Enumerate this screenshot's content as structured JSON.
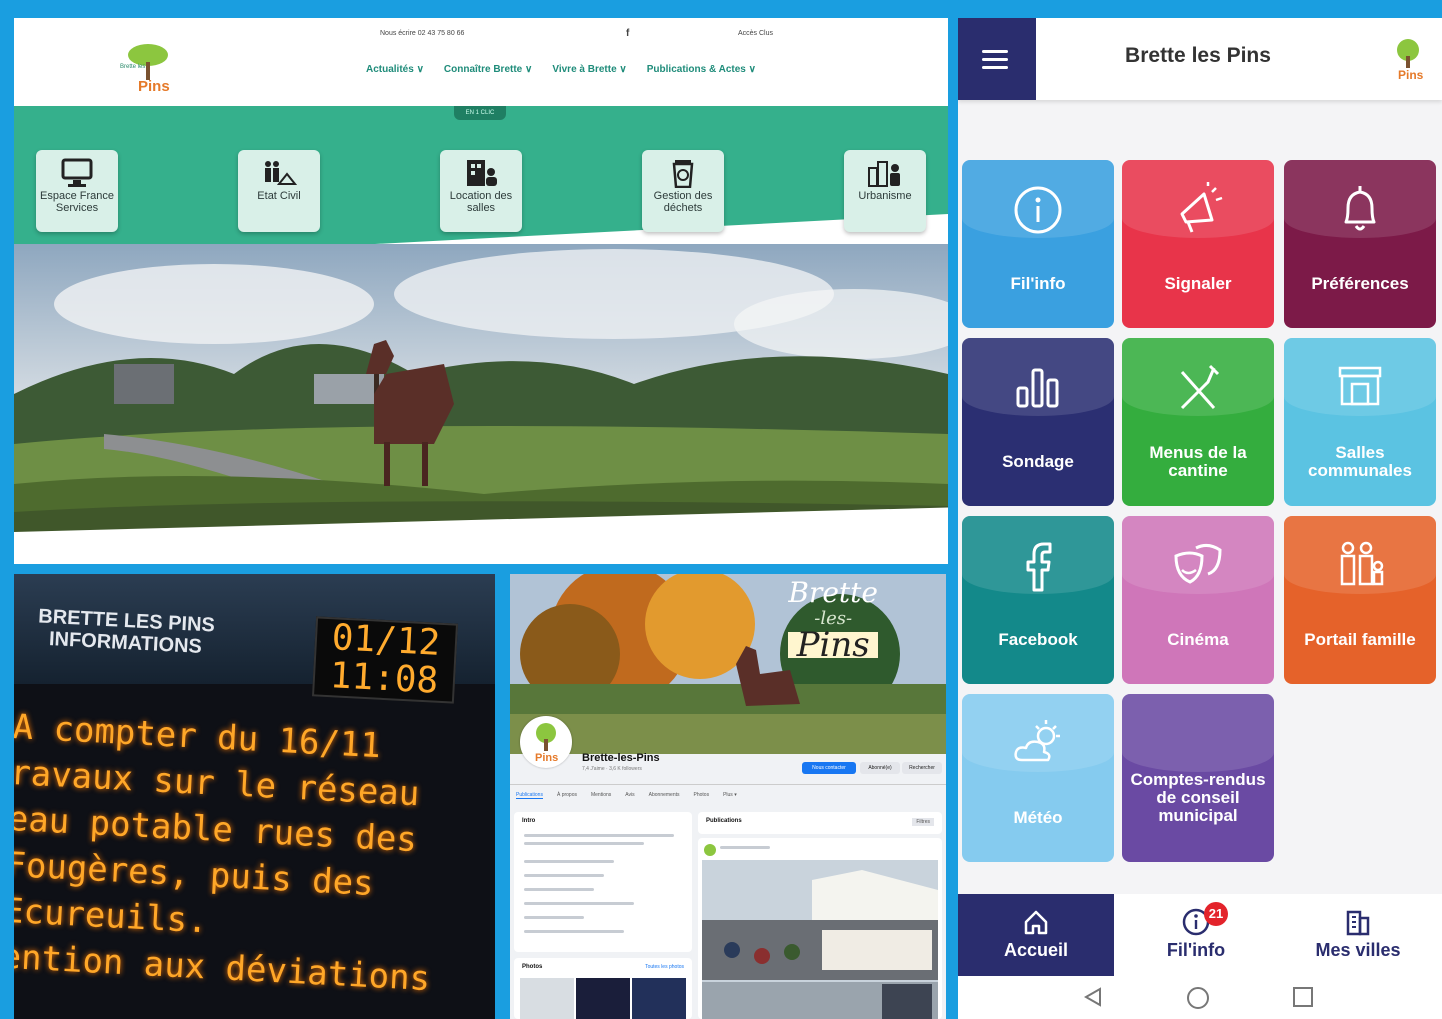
{
  "website": {
    "logo_text": "Pins",
    "logo_small": "Brette les",
    "topbar": {
      "contact": "Nous écrire  02 43 75 80 66",
      "facebook": "f",
      "access": "Accès Clus"
    },
    "nav": [
      "Actualités ∨",
      "Connaître Brette ∨",
      "Vivre à Brette ∨",
      "Publications & Actes ∨"
    ],
    "band_tab": "EN 1 CLIC",
    "quick_links": [
      {
        "label": "Espace France Services",
        "icon": "computer-icon"
      },
      {
        "label": "Etat Civil",
        "icon": "family-book-icon"
      },
      {
        "label": "Location des salles",
        "icon": "building-person-icon"
      },
      {
        "label": "Gestion des déchets",
        "icon": "recycle-bin-icon"
      },
      {
        "label": "Urbanisme",
        "icon": "city-builder-icon"
      }
    ]
  },
  "led_board": {
    "title_line1": "BRETTE LES PINS",
    "title_line2": "INFORMATIONS",
    "date": "01/12",
    "time": "11:08",
    "message": [
      "A compter du 16/11",
      "ravaux sur le réseau",
      "eau potable rues des",
      "Fougères, puis des",
      "   Ecureuils.",
      "ention aux déviations"
    ]
  },
  "facebook": {
    "cover_title": [
      "Brette",
      "-les-",
      "Pins"
    ],
    "page_name": "Brette-les-Pins",
    "subtitle": "7,4 J'aime · 3,6 K followers",
    "buttons": [
      "Nous contacter",
      "Abonné(e)",
      "Rechercher"
    ],
    "tabs": [
      "Publications",
      "À propos",
      "Mentions",
      "Avis",
      "Abonnements",
      "Photos",
      "Plus ▾"
    ],
    "intro_title": "Intro",
    "posts_title": "Publications",
    "photos_title": "Photos",
    "photos_link": "Toutes les photos",
    "filter": "Filtres"
  },
  "app": {
    "title": "Brette les Pins",
    "logo_text": "Pins",
    "tiles": [
      {
        "label": "Fil'info",
        "color": "#3aa0e0",
        "icon": "info-icon"
      },
      {
        "label": "Signaler",
        "color": "#e8344a",
        "icon": "megaphone-icon"
      },
      {
        "label": "Préférences",
        "color": "#7c1a48",
        "icon": "bell-icon"
      },
      {
        "label": "Sondage",
        "color": "#2b2f72",
        "icon": "bar-chart-icon"
      },
      {
        "label": "Menus de la cantine",
        "color": "#34ad3e",
        "icon": "cutlery-icon"
      },
      {
        "label": "Salles communales",
        "color": "#5bc3e2",
        "icon": "hall-icon"
      },
      {
        "label": "Facebook",
        "color": "#13898a",
        "icon": "facebook-icon"
      },
      {
        "label": "Cinéma",
        "color": "#cf76b9",
        "icon": "theater-masks-icon"
      },
      {
        "label": "Portail famille",
        "color": "#e5622a",
        "icon": "family-icon"
      },
      {
        "label": "Météo",
        "color": "#85cbef",
        "icon": "weather-icon"
      },
      {
        "label": "Comptes-rendus de conseil municipal",
        "color": "#6a4aa3",
        "icon": ""
      }
    ],
    "bottom_nav": [
      {
        "label": "Accueil",
        "icon": "home-icon",
        "active": true
      },
      {
        "label": "Fil'info",
        "icon": "info-icon",
        "badge": "21"
      },
      {
        "label": "Mes villes",
        "icon": "buildings-icon"
      }
    ]
  }
}
